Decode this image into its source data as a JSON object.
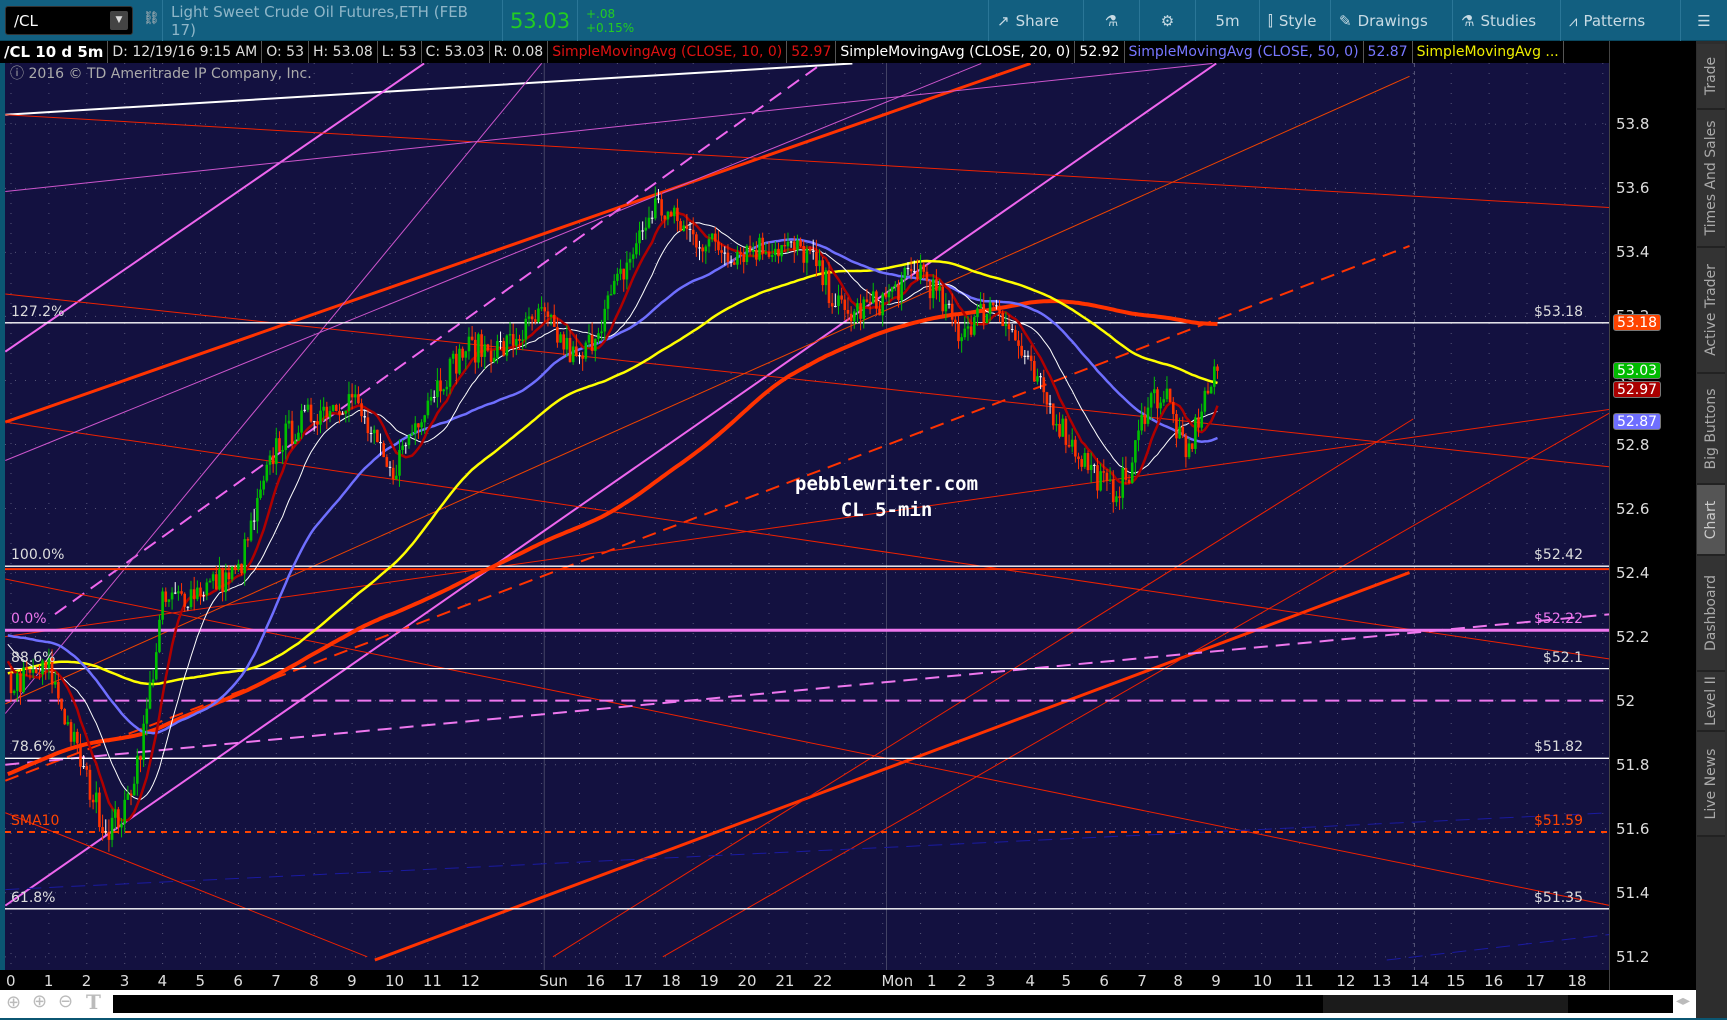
{
  "toolbar": {
    "symbol": "/CL",
    "description": "Light Sweet Crude Oil Futures,ETH (FEB 17)",
    "last": "53.03",
    "change": "+.08",
    "change_pct": "+0.15%",
    "share": "Share",
    "timeframe": "5m",
    "style": "Style",
    "drawings": "Drawings",
    "studies": "Studies",
    "patterns": "Patterns"
  },
  "infobar": {
    "title": "/CL 10 d 5m",
    "date": "D: 12/19/16 9:15 AM",
    "open": "O: 53",
    "high": "H: 53.08",
    "low": "L: 53",
    "close": "C: 53.03",
    "range": "R: 0.08",
    "sma10": "SimpleMovingAvg (CLOSE, 10, 0)",
    "sma10_val": "52.97",
    "sma20": "SimpleMovingAvg (CLOSE, 20, 0)",
    "sma20_val": "52.92",
    "sma50": "SimpleMovingAvg (CLOSE, 50, 0)",
    "sma50_val": "52.87",
    "sma_more": "SimpleMovingAvg ..."
  },
  "copyright": "2016 © TD Ameritrade IP Company, Inc.",
  "watermark": {
    "line1": "pebblewriter.com",
    "line2": "CL 5-min"
  },
  "price_axis": [
    "53.8",
    "53.6",
    "53.4",
    "53.2",
    "53",
    "52.8",
    "52.6",
    "52.4",
    "52.2",
    "52",
    "51.8",
    "51.6",
    "51.4",
    "51.2"
  ],
  "price_tags": [
    {
      "value": "53.18",
      "color": "#ff4400"
    },
    {
      "value": "53.03",
      "color": "#00bb00"
    },
    {
      "value": "52.97",
      "color": "#aa0000"
    },
    {
      "value": "52.87",
      "color": "#6f6fff"
    }
  ],
  "time_axis": [
    "0",
    "1",
    "2",
    "3",
    "4",
    "5",
    "6",
    "7",
    "8",
    "9",
    "10",
    "11",
    "12",
    "Sun",
    "16",
    "17",
    "18",
    "19",
    "20",
    "21",
    "22",
    "Mon",
    "1",
    "2",
    "3",
    "4",
    "5",
    "6",
    "7",
    "8",
    "9",
    "10",
    "11",
    "12",
    "13",
    "14",
    "15",
    "16",
    "17",
    "18"
  ],
  "levels": [
    {
      "label": "127.2%",
      "price": 53.18,
      "tag": "$53.18",
      "color": "#ffffff"
    },
    {
      "label": "100.0%",
      "price": 52.42,
      "tag": "$52.42",
      "color": "#ffffff"
    },
    {
      "label": "0.0%",
      "price": 52.22,
      "tag": "$52.22",
      "color": "#ee77ee"
    },
    {
      "label": "88.6%",
      "price": 52.1,
      "tag": "$52.1",
      "color": "#ffffff"
    },
    {
      "label": "78.6%",
      "price": 51.82,
      "tag": "$51.82",
      "color": "#ffffff"
    },
    {
      "label": "SMA10",
      "price": 51.59,
      "tag": "$51.59",
      "color": "#ff4400"
    },
    {
      "label": "61.8%",
      "price": 51.35,
      "tag": "$51.35",
      "color": "#ffffff"
    }
  ],
  "side_tabs": [
    "Trade",
    "Times And Sales",
    "Active Trader",
    "Big Buttons",
    "Chart",
    "Dashboard",
    "Level II",
    "Live News"
  ],
  "chart_data": {
    "type": "candlestick",
    "price_range": [
      51.15,
      54.0
    ],
    "price_path": [
      [
        -24,
        51.0
      ],
      [
        -14,
        51.3
      ],
      [
        -6,
        52.0
      ],
      [
        -2,
        52.3
      ],
      [
        0,
        52.05
      ],
      [
        1,
        52.1
      ],
      [
        2,
        51.75
      ],
      [
        2.5,
        51.6
      ],
      [
        3,
        51.65
      ],
      [
        3.5,
        51.9
      ],
      [
        4,
        52.3
      ],
      [
        5,
        52.35
      ],
      [
        6,
        52.4
      ],
      [
        7,
        52.8
      ],
      [
        8,
        52.9
      ],
      [
        9,
        52.95
      ],
      [
        10,
        52.7
      ],
      [
        11,
        52.95
      ],
      [
        12,
        53.1
      ],
      [
        13,
        53.1
      ],
      [
        14,
        53.2
      ],
      [
        15,
        53.05
      ],
      [
        16,
        53.3
      ],
      [
        17,
        53.55
      ],
      [
        18,
        53.45
      ],
      [
        19,
        53.4
      ],
      [
        20,
        53.42
      ],
      [
        21,
        53.4
      ],
      [
        22,
        53.2
      ],
      [
        23,
        53.25
      ],
      [
        24,
        53.35
      ],
      [
        25,
        53.15
      ],
      [
        26,
        53.25
      ],
      [
        27,
        53.0
      ],
      [
        28,
        52.8
      ],
      [
        29,
        52.65
      ],
      [
        29.5,
        52.7
      ],
      [
        30,
        52.95
      ],
      [
        30.5,
        52.95
      ],
      [
        31,
        52.75
      ],
      [
        31.5,
        52.95
      ],
      [
        31.9,
        53.03
      ]
    ],
    "moving_averages": [
      {
        "period": 10,
        "color": "#b00000"
      },
      {
        "period": 20,
        "color": "#ffffff"
      },
      {
        "period": 50,
        "color": "#6f6fff"
      },
      {
        "period": 100,
        "color": "#ffff00"
      },
      {
        "period": 200,
        "color": "#ff3300"
      }
    ],
    "trendlines": [
      {
        "p": [
          [
            -0.15,
            53.83
          ],
          [
            22.2,
            53.99
          ]
        ],
        "color": "#ffffff",
        "w": 2
      },
      {
        "p": [
          [
            -0.15,
            52.87
          ],
          [
            26.9,
            53.99
          ]
        ],
        "color": "#ff3300",
        "w": 3
      },
      {
        "p": [
          [
            -0.15,
            53.09
          ],
          [
            10.9,
            53.99
          ]
        ],
        "color": "#ee66ee",
        "w": 2
      },
      {
        "p": [
          [
            1.16,
            52.27
          ],
          [
            21.4,
            53.99
          ]
        ],
        "color": "#ee66ee",
        "w": 2,
        "dash": true
      },
      {
        "p": [
          [
            -0.15,
            51.36
          ],
          [
            31.8,
            53.99
          ]
        ],
        "color": "#ee66ee",
        "w": 2
      },
      {
        "p": [
          [
            9.6,
            51.19
          ],
          [
            36.9,
            52.4
          ]
        ],
        "color": "#ff3300",
        "w": 3
      },
      {
        "p": [
          [
            -0.15,
            51.75
          ],
          [
            36.9,
            53.42
          ]
        ],
        "color": "#ff3300",
        "w": 2,
        "dash": true
      },
      {
        "p": [
          [
            -0.15,
            53.83
          ],
          [
            42.2,
            53.54
          ]
        ],
        "color": "#ee2200",
        "w": 1
      },
      {
        "p": [
          [
            -0.15,
            53.27
          ],
          [
            42.2,
            52.73
          ]
        ],
        "color": "#ee2200",
        "w": 1
      },
      {
        "p": [
          [
            -0.15,
            52.87
          ],
          [
            42.2,
            52.13
          ]
        ],
        "color": "#ee2200",
        "w": 1
      },
      {
        "p": [
          [
            -0.15,
            52.38
          ],
          [
            42.2,
            51.36
          ]
        ],
        "color": "#ee2200",
        "w": 1
      },
      {
        "p": [
          [
            -0.15,
            51.65
          ],
          [
            9.4,
            51.2
          ]
        ],
        "color": "#ee2200",
        "w": 1
      },
      {
        "p": [
          [
            -0.15,
            52.2
          ],
          [
            42.2,
            52.91
          ]
        ],
        "color": "#ee2200",
        "w": 1
      },
      {
        "p": [
          [
            14.3,
            51.2
          ],
          [
            37,
            52.88
          ]
        ],
        "color": "#ee2200",
        "w": 1
      },
      {
        "p": [
          [
            17.2,
            51.2
          ],
          [
            42.2,
            52.9
          ]
        ],
        "color": "#ee2200",
        "w": 1
      },
      {
        "p": [
          [
            -0.15,
            51.99
          ],
          [
            36.9,
            53.95
          ]
        ],
        "color": "#ee4400",
        "w": 1
      },
      {
        "p": [
          [
            -0.15,
            51.8
          ],
          [
            42.2,
            52.27
          ]
        ],
        "color": "#ee77ee",
        "w": 2,
        "dash": true
      },
      {
        "p": [
          [
            -0.15,
            52.0
          ],
          [
            42.2,
            52.0
          ]
        ],
        "color": "#ee77ee",
        "w": 2,
        "dash": true
      },
      {
        "p": [
          [
            -0.15,
            52.75
          ],
          [
            25.6,
            53.99
          ]
        ],
        "color": "#cc55cc",
        "w": 1
      },
      {
        "p": [
          [
            -0.15,
            53.59
          ],
          [
            31.7,
            53.99
          ]
        ],
        "color": "#cc55cc",
        "w": 1
      },
      {
        "p": [
          [
            -0.15,
            51.96
          ],
          [
            14,
            53.99
          ]
        ],
        "color": "#cc55cc",
        "w": 1
      },
      {
        "p": [
          [
            -0.15,
            51.41
          ],
          [
            42.2,
            51.65
          ]
        ],
        "color": "#1a1aa0",
        "w": 1,
        "dash": true
      },
      {
        "p": [
          [
            36.3,
            51.19
          ],
          [
            42.2,
            51.27
          ]
        ],
        "color": "#1a1aa0",
        "w": 1,
        "dash": true
      }
    ]
  }
}
